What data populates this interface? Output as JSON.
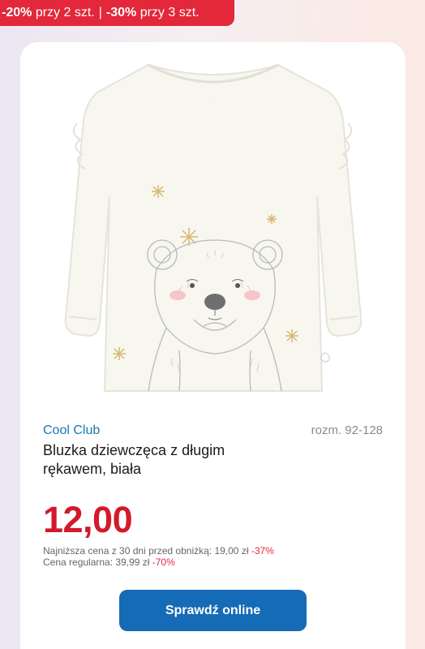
{
  "promo": {
    "discount1": "-20%",
    "text1": "przy 2 szt.",
    "separator": "|",
    "discount2": "-30%",
    "text2": "przy 3 szt."
  },
  "product": {
    "brand": "Cool Club",
    "sizes": "rozm. 92-128",
    "title": "Bluzka dziewczęca z długim rękawem, biała",
    "price": "12,00",
    "lowest_price_label": "Najniższa cena z 30 dni przed obniżką: 19,00 zł",
    "lowest_price_discount": "-37%",
    "regular_price_label": "Cena regularna: 39,99 zł",
    "regular_price_discount": "-70%",
    "cta_label": "Sprawdź online"
  },
  "colors": {
    "accent_red": "#e2283a",
    "brand_blue": "#1a78b4",
    "button_blue": "#156bb5"
  }
}
